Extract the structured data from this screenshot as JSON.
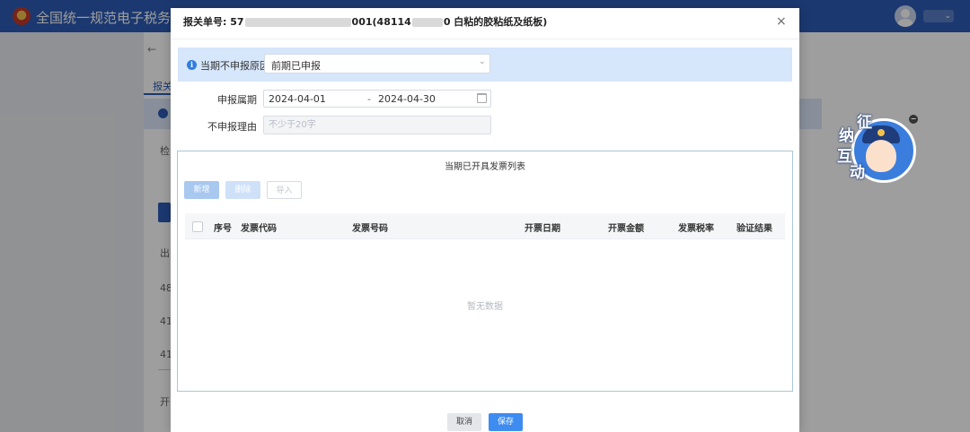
{
  "app": {
    "title": "全国统一规范电子税务局",
    "header_color": "#2c5bb5"
  },
  "background_page": {
    "back_label": "← 𝅘",
    "tab_label": "报关",
    "row_prefixes": [
      "检",
      "出",
      "48",
      "41",
      "41",
      "开"
    ]
  },
  "mascot": {
    "chars": [
      "征",
      "纳",
      "互",
      "动"
    ]
  },
  "dialog": {
    "title_prefix": "报关单号: 57",
    "title_mid": "001(48114",
    "title_suffix": "0 白粘的胶粘纸及纸板)",
    "close_icon": "×",
    "reason": {
      "label": "当期不申报原因",
      "value": "前期已申报",
      "arrow": "⌄"
    },
    "period": {
      "label": "申报属期",
      "start": "2024-04-01",
      "separator": "-",
      "end": "2024-04-30"
    },
    "no_declare_reason": {
      "label": "不申报理由",
      "placeholder": "不少于20字"
    },
    "invoice_panel": {
      "title": "当期已开具发票列表",
      "buttons": {
        "add": "新增",
        "delete": "删除",
        "import": "导入"
      },
      "columns": [
        "序号",
        "发票代码",
        "发票号码",
        "开票日期",
        "开票金额",
        "发票税率",
        "验证结果"
      ],
      "empty_text": "暂无数据"
    },
    "footer": {
      "cancel": "取消",
      "save": "保存"
    }
  },
  "colors": {
    "primary": "#3f8cf0",
    "info_bar": "#d6e6fb",
    "panel_border": "#a9c7d6"
  }
}
